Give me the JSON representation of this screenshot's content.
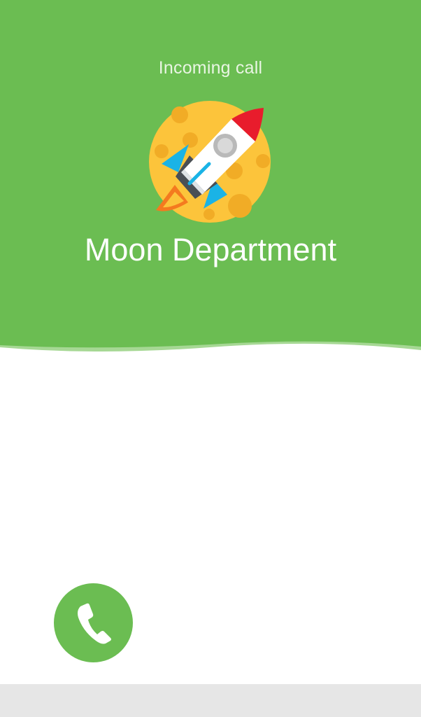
{
  "call": {
    "status_label": "Incoming call",
    "caller_name": "Moon Department"
  },
  "avatar": {
    "icon": "rocket-moon-icon"
  },
  "actions": {
    "answer_icon": "phone-icon"
  },
  "colors": {
    "header_green": "#6bbd52",
    "header_wave_light": "#a6d894",
    "answer_button_green": "#6bbd52",
    "moon_yellow": "#fcc43b",
    "moon_crater": "#f1ac26",
    "rocket_red": "#e81c2c",
    "rocket_blue": "#1ab3e6",
    "rocket_dark": "#4a4f55",
    "flame_orange": "#f47a1f",
    "bottom_bar": "#e6e6e6"
  }
}
